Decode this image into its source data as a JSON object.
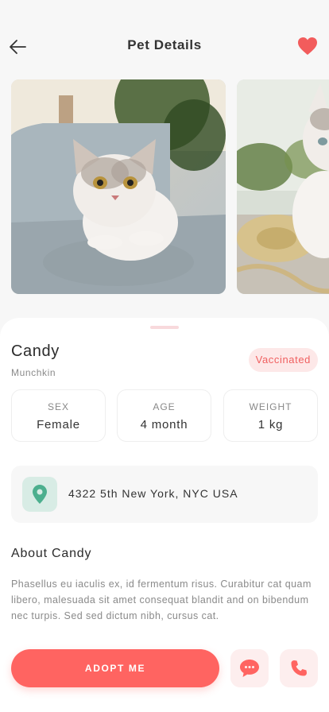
{
  "header": {
    "title": "Pet Details",
    "back_icon": "arrow-left-icon",
    "favorite_icon": "heart-icon",
    "favorite_color": "#f25c5c"
  },
  "gallery": {
    "photos": [
      "cat-on-sofa-photo",
      "cat-with-straw-hat-photo"
    ]
  },
  "pet": {
    "name": "Candy",
    "breed": "Munchkin",
    "badge": "Vaccinated"
  },
  "stats": [
    {
      "label": "SEX",
      "value": "Female"
    },
    {
      "label": "AGE",
      "value": "4 month"
    },
    {
      "label": "WEIGHT",
      "value": "1 kg"
    }
  ],
  "location": {
    "address": "4322 5th New York, NYC USA",
    "icon": "location-pin-icon",
    "icon_color": "#4caf8e"
  },
  "about": {
    "title": "About Candy",
    "text": "Phasellus eu iaculis ex, id fermentum risus. Curabitur cat quam libero, malesuada sit amet consequat blandit and on bibendum nec turpis. Sed sed dictum nibh, cursus cat."
  },
  "actions": {
    "adopt_label": "ADOPT ME",
    "chat_icon": "chat-bubble-icon",
    "call_icon": "phone-icon",
    "accent": "#ff6461"
  }
}
